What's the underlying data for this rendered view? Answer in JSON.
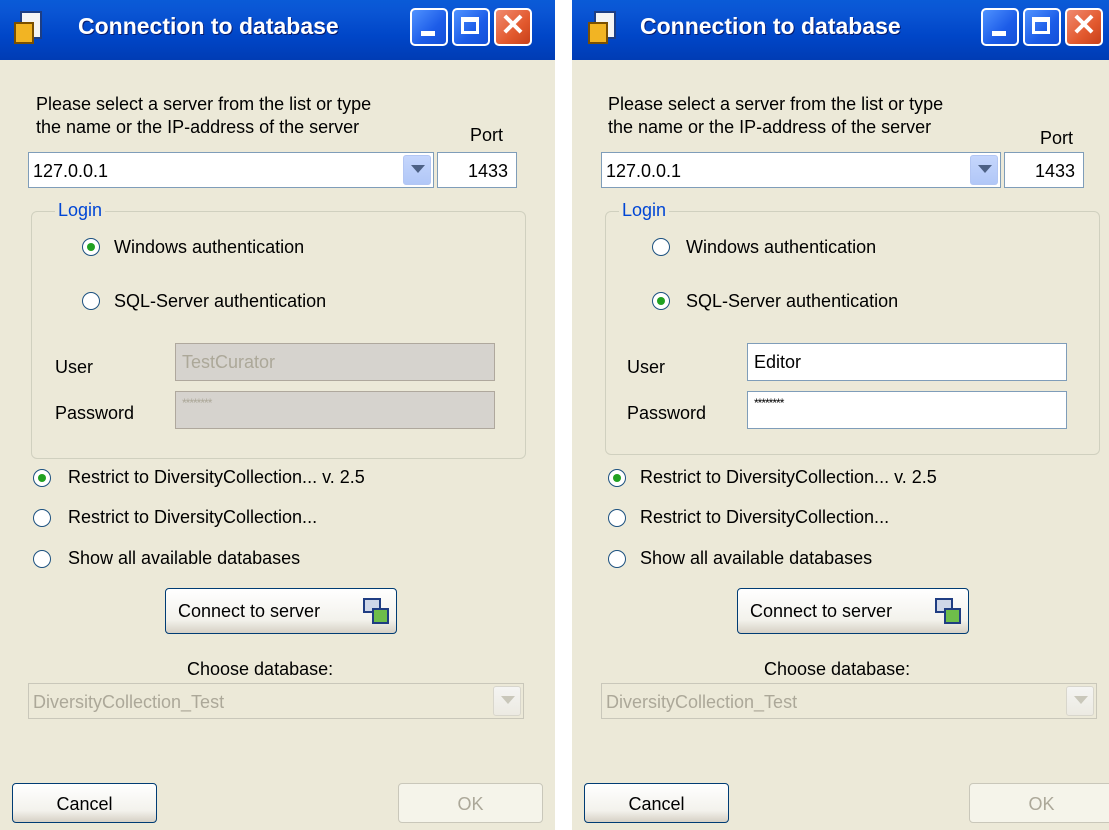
{
  "dialogs": [
    {
      "title": "Connection to database",
      "prompt_line1": "Please select a server from the list or type",
      "prompt_line2": "the name or the IP-address of the server",
      "port_label": "Port",
      "server": "127.0.0.1",
      "port": "1433",
      "login_legend": "Login",
      "auth_windows_label": "Windows authentication",
      "auth_sql_label": "SQL-Server authentication",
      "selected_auth": "windows",
      "user_label": "User",
      "user_value": "TestCurator",
      "password_label": "Password",
      "password_value": "********",
      "credentials_enabled": false,
      "restrict_v25_label": "Restrict to DiversityCollection... v. 2.5",
      "restrict_label": "Restrict to DiversityCollection...",
      "show_all_label": "Show all available databases",
      "selected_filter": "restrict_v25",
      "connect_label": "Connect to server",
      "choose_db_label": "Choose database:",
      "database": "DiversityCollection_Test",
      "cancel_label": "Cancel",
      "ok_label": "OK"
    },
    {
      "title": "Connection to database",
      "prompt_line1": "Please select a server from the list or type",
      "prompt_line2": "the name or the IP-address of the server",
      "port_label": "Port",
      "server": "127.0.0.1",
      "port": "1433",
      "login_legend": "Login",
      "auth_windows_label": "Windows authentication",
      "auth_sql_label": "SQL-Server authentication",
      "selected_auth": "sql",
      "user_label": "User",
      "user_value": "Editor",
      "password_label": "Password",
      "password_value": "********",
      "credentials_enabled": true,
      "restrict_v25_label": "Restrict to DiversityCollection... v. 2.5",
      "restrict_label": "Restrict to DiversityCollection...",
      "show_all_label": "Show all available databases",
      "selected_filter": "restrict_v25",
      "connect_label": "Connect to server",
      "choose_db_label": "Choose database:",
      "database": "DiversityCollection_Test",
      "cancel_label": "Cancel",
      "ok_label": "OK"
    }
  ],
  "colors": {
    "titlebar": "#0054e3",
    "dialog_bg": "#ece9d8",
    "legend": "#0046d5",
    "radio_dot": "#21a121",
    "disabled_text": "#aca899"
  }
}
